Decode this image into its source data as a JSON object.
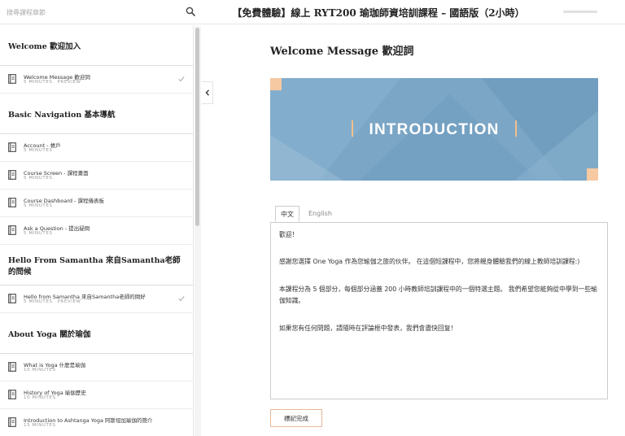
{
  "search": {
    "placeholder": "搜尋課程章節"
  },
  "header": {
    "course_title": "【免費體驗】線上 RYT200 瑜珈師資培訓課程 – 國語版（2小時）",
    "progress": 0
  },
  "sidebar": {
    "sections": [
      {
        "title": "Welcome 歡迎加入",
        "lessons": [
          {
            "title": "Welcome Message 歡迎詞",
            "duration": "5 MINUTES",
            "preview": "PREVIEW",
            "completed": true
          }
        ]
      },
      {
        "title": "Basic Navigation 基本導航",
        "lessons": [
          {
            "title": "Account - 帳戶",
            "duration": "5 MINUTES"
          },
          {
            "title": "Course Screen - 課程畫面",
            "duration": "5 MINUTES"
          },
          {
            "title": "Course Dashboard - 課程儀表板",
            "duration": "5 MINUTES"
          },
          {
            "title": "Ask a Question - 提出疑問",
            "duration": "5 MINUTES"
          }
        ]
      },
      {
        "title": "Hello From Samantha 來自Samantha老師的問候",
        "lessons": [
          {
            "title": "Hello from Samantha 來自Samantha老師的問好",
            "duration": "5 MINUTES",
            "preview": "PREVIEW",
            "completed": true
          }
        ]
      },
      {
        "title": "About Yoga 關於瑜伽",
        "lessons": [
          {
            "title": "What is Yoga 什麼是瑜伽",
            "duration": "10 MINUTES"
          },
          {
            "title": "History of Yoga 瑜伽歷史",
            "duration": "10 MINUTES"
          },
          {
            "title": "Introduction to Ashtanga Yoga 阿斯坦加瑜伽的簡介",
            "duration": "15 MINUTES"
          }
        ]
      }
    ]
  },
  "main": {
    "lesson_title": "Welcome Message 歡迎詞",
    "banner_text": "INTRODUCTION",
    "tabs": [
      {
        "label": "中文",
        "active": true
      },
      {
        "label": "English",
        "active": false
      }
    ],
    "paragraphs": [
      "歡迎！",
      "感謝您選擇 One Yoga 作為您瑜伽之旅的伙伴。 在這個短課程中，您將親身體驗我們的線上教師培訓課程:)",
      "本課程分為 5 個部分，每個部分涵蓋 200 小時教師培訓課程中的一個特選主題。 我們希望您能夠從中學到一些瑜伽知識。",
      "如果您有任何問題，請隨時在評論框中發表，我們會盡快回复！"
    ],
    "complete_label": "標記完成"
  },
  "colors": {
    "banner_bg": "#7ba6c6",
    "banner_accent": "#f6c9a2",
    "button_border": "#e9b89a"
  }
}
